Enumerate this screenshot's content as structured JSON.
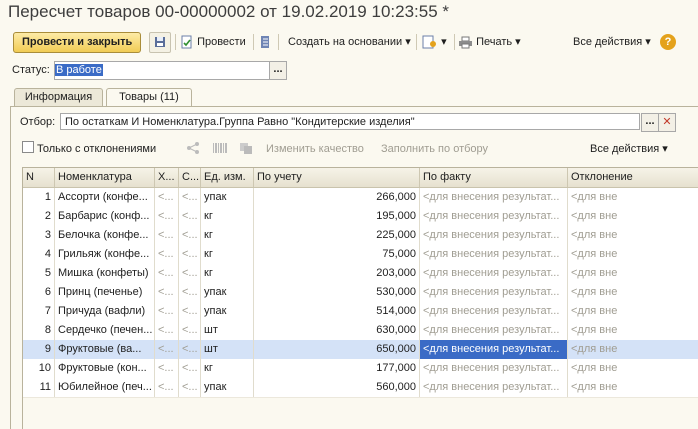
{
  "window": {
    "title": "Пересчет товаров 00-00000002 от 19.02.2019 10:23:55 *"
  },
  "toolbar": {
    "post_close": "Провести и закрыть",
    "post": "Провести",
    "create_based": "Создать на основании",
    "print": "Печать",
    "all_actions": "Все действия",
    "help": "?"
  },
  "status": {
    "label": "Статус:",
    "value": "В работе",
    "select": "..."
  },
  "tabs": [
    {
      "label": "Информация"
    },
    {
      "label": "Товары (11)"
    }
  ],
  "filter": {
    "label": "Отбор:",
    "value": "По остаткам И Номенклатура.Группа Равно \"Кондитерские изделия\"",
    "select": "...",
    "clear": "✕"
  },
  "table_toolbar": {
    "only_deviations": "Только с отклонениями",
    "change_quality": "Изменить качество",
    "fill_by_filter": "Заполнить по отбору",
    "all_actions": "Все действия"
  },
  "table": {
    "columns": {
      "n": "N",
      "name": "Номенклатура",
      "x": "Х...",
      "c": "С...",
      "unit": "Ед. изм.",
      "account": "По учету",
      "fact": "По факту",
      "deviation": "Отклонение"
    },
    "rows": [
      {
        "n": "1",
        "name": "Ассорти (конфе...",
        "x": "<...",
        "c": "<...",
        "unit": "упак",
        "account": "266,000",
        "fact": "<для внесения результат...",
        "dev": "<для вне"
      },
      {
        "n": "2",
        "name": "Барбарис (конф...",
        "x": "<...",
        "c": "<...",
        "unit": "кг",
        "account": "195,000",
        "fact": "<для внесения результат...",
        "dev": "<для вне"
      },
      {
        "n": "3",
        "name": "Белочка (конфе...",
        "x": "<...",
        "c": "<...",
        "unit": "кг",
        "account": "225,000",
        "fact": "<для внесения результат...",
        "dev": "<для вне"
      },
      {
        "n": "4",
        "name": "Грильяж (конфе...",
        "x": "<...",
        "c": "<...",
        "unit": "кг",
        "account": "75,000",
        "fact": "<для внесения результат...",
        "dev": "<для вне"
      },
      {
        "n": "5",
        "name": "Мишка (конфеты)",
        "x": "<...",
        "c": "<...",
        "unit": "кг",
        "account": "203,000",
        "fact": "<для внесения результат...",
        "dev": "<для вне"
      },
      {
        "n": "6",
        "name": "Принц (печенье)",
        "x": "<...",
        "c": "<...",
        "unit": "упак",
        "account": "530,000",
        "fact": "<для внесения результат...",
        "dev": "<для вне"
      },
      {
        "n": "7",
        "name": "Причуда (вафли)",
        "x": "<...",
        "c": "<...",
        "unit": "упак",
        "account": "514,000",
        "fact": "<для внесения результат...",
        "dev": "<для вне"
      },
      {
        "n": "8",
        "name": "Сердечко (печен...",
        "x": "<...",
        "c": "<...",
        "unit": "шт",
        "account": "630,000",
        "fact": "<для внесения результат...",
        "dev": "<для вне"
      },
      {
        "n": "9",
        "name": "Фруктовые (ва...",
        "x": "<...",
        "c": "<...",
        "unit": "шт",
        "account": "650,000",
        "fact": "<для внесения результат...",
        "dev": "<для вне"
      },
      {
        "n": "10",
        "name": "Фруктовые (кон...",
        "x": "<...",
        "c": "<...",
        "unit": "кг",
        "account": "177,000",
        "fact": "<для внесения результат...",
        "dev": "<для вне"
      },
      {
        "n": "11",
        "name": "Юбилейное (печ...",
        "x": "<...",
        "c": "<...",
        "unit": "упак",
        "account": "560,000",
        "fact": "<для внесения результат...",
        "dev": "<для вне"
      }
    ]
  },
  "colors": {
    "accent_button": "#f1cc55",
    "selection": "#3a6bc6",
    "selected_row": "#d4e2f7"
  }
}
